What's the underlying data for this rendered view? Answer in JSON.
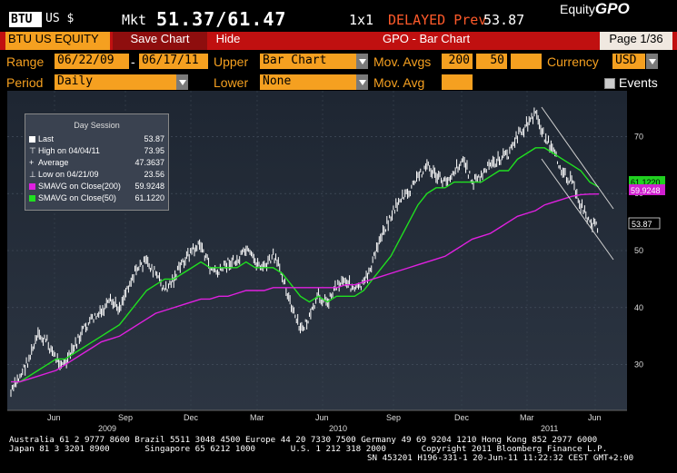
{
  "header": {
    "ticker": "BTU",
    "currency": "US $",
    "mkt_label": "Mkt",
    "mkt_price": "51.37/61.47",
    "mkt_size": "1x1",
    "delayed_text": "DELAYED Prev",
    "prev_value": "53.87",
    "brand_prefix": "Equity",
    "brand_suffix": "GPO"
  },
  "redbar": {
    "security": "BTU US EQUITY",
    "save_chart": "Save Chart",
    "hide": "Hide",
    "title": "GPO - Bar Chart",
    "page": "Page 1/36"
  },
  "controls": {
    "range_label": "Range",
    "range_start": "06/22/09",
    "range_sep": "-",
    "range_end": "06/17/11",
    "upper_label": "Upper",
    "upper_value": "Bar Chart",
    "mov_avgs_label": "Mov. Avgs",
    "mov_avg_1": "200",
    "mov_avg_2": "50",
    "currency_label": "Currency",
    "currency_value": "USD",
    "period_label": "Period",
    "period_value": "Daily",
    "lower_label": "Lower",
    "lower_value": "None",
    "mov_avg_label": "Mov. Avg",
    "events_label": "Events"
  },
  "legend": {
    "title": "Day Session",
    "rows": [
      {
        "label": "Last",
        "value": "53.87",
        "color": "#ffffff"
      },
      {
        "label": "High on 04/04/11",
        "value": "73.95",
        "color": "#ffffff"
      },
      {
        "label": "Average",
        "value": "47.3637",
        "color": "#ffffff"
      },
      {
        "label": "Low on 04/21/09",
        "value": "23.56",
        "color": "#ffffff"
      },
      {
        "label": "SMAVG on Close(200)",
        "value": "59.9248",
        "color": "#e020e0"
      },
      {
        "label": "SMAVG on Close(50)",
        "value": "61.1220",
        "color": "#20e020"
      }
    ]
  },
  "chart_data": {
    "type": "line",
    "title": "GPO - Bar Chart",
    "ylim": [
      22,
      78
    ],
    "y_ticks": [
      30,
      40,
      50,
      60,
      70
    ],
    "y_tick_labels": [
      "30",
      "40",
      "50",
      "60",
      "70"
    ],
    "x_month_labels": [
      "Jun",
      "Sep",
      "Dec",
      "Mar",
      "Jun",
      "Sep",
      "Dec",
      "Mar",
      "Jun"
    ],
    "x_year_labels": [
      "2009",
      "2010",
      "2011"
    ],
    "price_tag_last": "53.87",
    "price_tag_sma200": "59.9248",
    "price_tag_sma50": "61.1220",
    "series": [
      {
        "name": "Price (Bar)",
        "color": "#ffffff",
        "values": [
          25,
          28,
          31,
          35,
          34,
          31,
          30,
          33,
          36,
          38,
          39,
          41,
          40,
          44,
          47,
          48,
          46,
          43,
          45,
          48,
          50,
          51,
          47,
          46,
          48,
          48,
          50,
          48,
          47,
          49,
          46,
          40,
          36,
          38,
          42,
          41,
          44,
          45,
          43,
          44,
          48,
          53,
          56,
          59,
          60,
          63,
          65,
          63,
          62,
          64,
          66,
          62,
          63,
          65,
          66,
          67,
          70,
          72,
          74,
          70,
          67,
          64,
          62,
          58,
          55,
          53.87
        ]
      },
      {
        "name": "SMAVG on Close(50)",
        "color": "#20e020",
        "values": [
          27,
          27,
          28,
          29,
          30,
          31,
          31,
          32,
          33,
          34,
          35,
          36,
          37,
          39,
          41,
          43,
          44,
          45,
          45,
          46,
          47,
          48,
          47,
          47,
          47,
          47,
          48,
          47,
          47,
          47,
          46,
          44,
          42,
          41,
          42,
          41,
          42,
          42,
          42,
          43,
          45,
          47,
          49,
          52,
          55,
          58,
          60,
          61,
          61,
          62,
          62,
          62,
          62,
          63,
          64,
          64,
          66,
          67,
          68,
          68,
          67,
          66,
          65,
          64,
          62,
          61.12
        ]
      },
      {
        "name": "SMAVG on Close(200)",
        "color": "#e020e0",
        "values": [
          27,
          27,
          27.5,
          28,
          28.5,
          29,
          30,
          31,
          32,
          33,
          34,
          34.5,
          35,
          36,
          37,
          38,
          39,
          39.5,
          40,
          40.5,
          41,
          41.5,
          41.5,
          42,
          42,
          42.5,
          43,
          43,
          43,
          43.5,
          43.5,
          43.5,
          43.5,
          43.5,
          43.5,
          43.5,
          43.5,
          44,
          44,
          44.5,
          45,
          45.5,
          46,
          46.5,
          47,
          47.5,
          48,
          48.5,
          49,
          50,
          51,
          52,
          52.5,
          53,
          54,
          55,
          56,
          56.5,
          57,
          58,
          58.5,
          59,
          59.5,
          59.8,
          59.9,
          59.92
        ]
      }
    ]
  },
  "footer": {
    "line1": "Australia 61 2 9777 8600 Brazil 5511 3048 4500 Europe 44 20 7330 7500 Germany 49 69 9204 1210 Hong Kong 852 2977 6000",
    "line2": "Japan 81 3 3201 8900       Singapore 65 6212 1000       U.S. 1 212 318 2000       Copyright 2011 Bloomberg Finance L.P.",
    "line3": "SN 453201 H196-331-1 20-Jun-11 11:22:32 CEST GMT+2:00"
  }
}
